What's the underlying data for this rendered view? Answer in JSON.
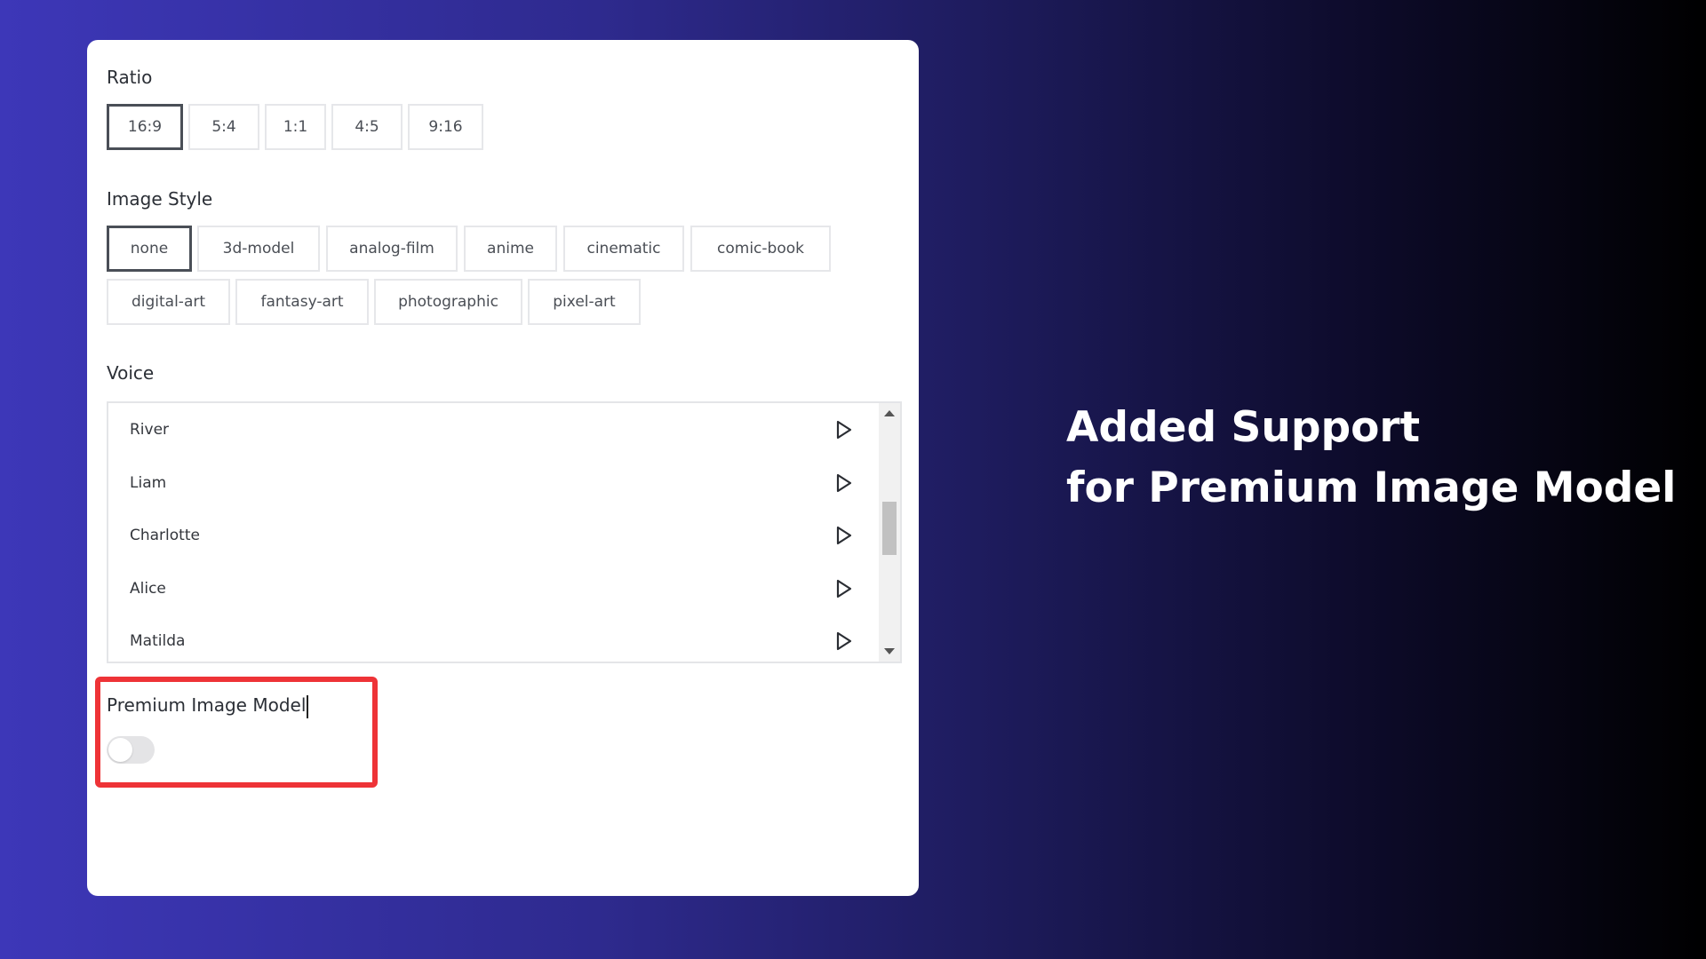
{
  "ratio": {
    "label": "Ratio",
    "selected": "16:9",
    "options": [
      "16:9",
      "5:4",
      "1:1",
      "4:5",
      "9:16"
    ]
  },
  "image_style": {
    "label": "Image Style",
    "selected": "none",
    "options": [
      "none",
      "3d-model",
      "analog-film",
      "anime",
      "cinematic",
      "comic-book",
      "digital-art",
      "fantasy-art",
      "photographic",
      "pixel-art"
    ]
  },
  "voice": {
    "label": "Voice",
    "items": [
      {
        "name": "River",
        "icon": "play-icon"
      },
      {
        "name": "Liam",
        "icon": "play-icon"
      },
      {
        "name": "Charlotte",
        "icon": "play-icon"
      },
      {
        "name": "Alice",
        "icon": "play-icon"
      },
      {
        "name": "Matilda",
        "icon": "play-icon"
      }
    ]
  },
  "premium_image_model": {
    "label": "Premium Image Model",
    "enabled": false,
    "highlight_color": "#ee3337"
  },
  "headline": {
    "line1": "Added Support",
    "line2": "for Premium Image Model"
  }
}
